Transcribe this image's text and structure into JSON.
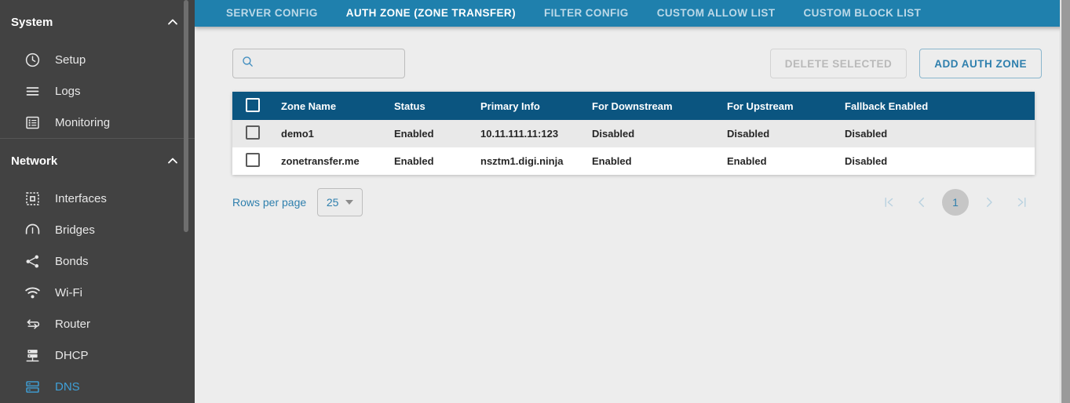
{
  "sidebar": {
    "sections": [
      {
        "title": "System",
        "icon": "chevron-up-icon",
        "items": [
          {
            "label": "Setup",
            "icon": "clock-icon",
            "active": false
          },
          {
            "label": "Logs",
            "icon": "list-lines-icon",
            "active": false
          },
          {
            "label": "Monitoring",
            "icon": "monitor-list-icon",
            "active": false
          }
        ]
      },
      {
        "title": "Network",
        "icon": "chevron-up-icon",
        "items": [
          {
            "label": "Interfaces",
            "icon": "interfaces-dashed-square-icon",
            "active": false
          },
          {
            "label": "Bridges",
            "icon": "bridge-arc-icon",
            "active": false
          },
          {
            "label": "Bonds",
            "icon": "share-nodes-icon",
            "active": false
          },
          {
            "label": "Wi-Fi",
            "icon": "wifi-icon",
            "active": false
          },
          {
            "label": "Router",
            "icon": "router-arrows-icon",
            "active": false
          },
          {
            "label": "DHCP",
            "icon": "dhcp-server-icon",
            "active": false
          },
          {
            "label": "DNS",
            "icon": "dns-server-icon",
            "active": true
          }
        ]
      }
    ]
  },
  "tabs": [
    {
      "label": "SERVER CONFIG",
      "active": false
    },
    {
      "label": "AUTH ZONE (ZONE TRANSFER)",
      "active": true
    },
    {
      "label": "FILTER CONFIG",
      "active": false
    },
    {
      "label": "CUSTOM ALLOW LIST",
      "active": false
    },
    {
      "label": "CUSTOM BLOCK LIST",
      "active": false
    }
  ],
  "toolbar": {
    "search_value": "",
    "search_placeholder": "",
    "search_icon": "search-icon",
    "delete_selected_label": "DELETE SELECTED",
    "add_auth_zone_label": "ADD AUTH ZONE"
  },
  "table": {
    "columns": [
      "Zone Name",
      "Status",
      "Primary Info",
      "For Downstream",
      "For Upstream",
      "Fallback Enabled"
    ],
    "rows": [
      {
        "checked": false,
        "zone_name": "demo1",
        "status": "Enabled",
        "primary_info": "10.11.111.11:123",
        "for_downstream": "Disabled",
        "for_upstream": "Disabled",
        "fallback_enabled": "Disabled"
      },
      {
        "checked": false,
        "zone_name": "zonetransfer.me",
        "status": "Enabled",
        "primary_info": "nsztm1.digi.ninja",
        "for_downstream": "Enabled",
        "for_upstream": "Enabled",
        "fallback_enabled": "Disabled"
      }
    ]
  },
  "pagination": {
    "rows_per_page_label": "Rows per page",
    "rows_per_page_value": "25",
    "current_page": "1",
    "first_icon": "first-page-icon",
    "prev_icon": "prev-page-icon",
    "next_icon": "next-page-icon",
    "last_icon": "last-page-icon"
  },
  "colors": {
    "tabbar_blue": "#1f80ad",
    "table_header_blue": "#0b5580",
    "sidebar_grey": "#424242",
    "accent_link_blue": "#2e7fad",
    "active_nav_blue": "#3fa0d8",
    "page_background": "#ededed"
  }
}
